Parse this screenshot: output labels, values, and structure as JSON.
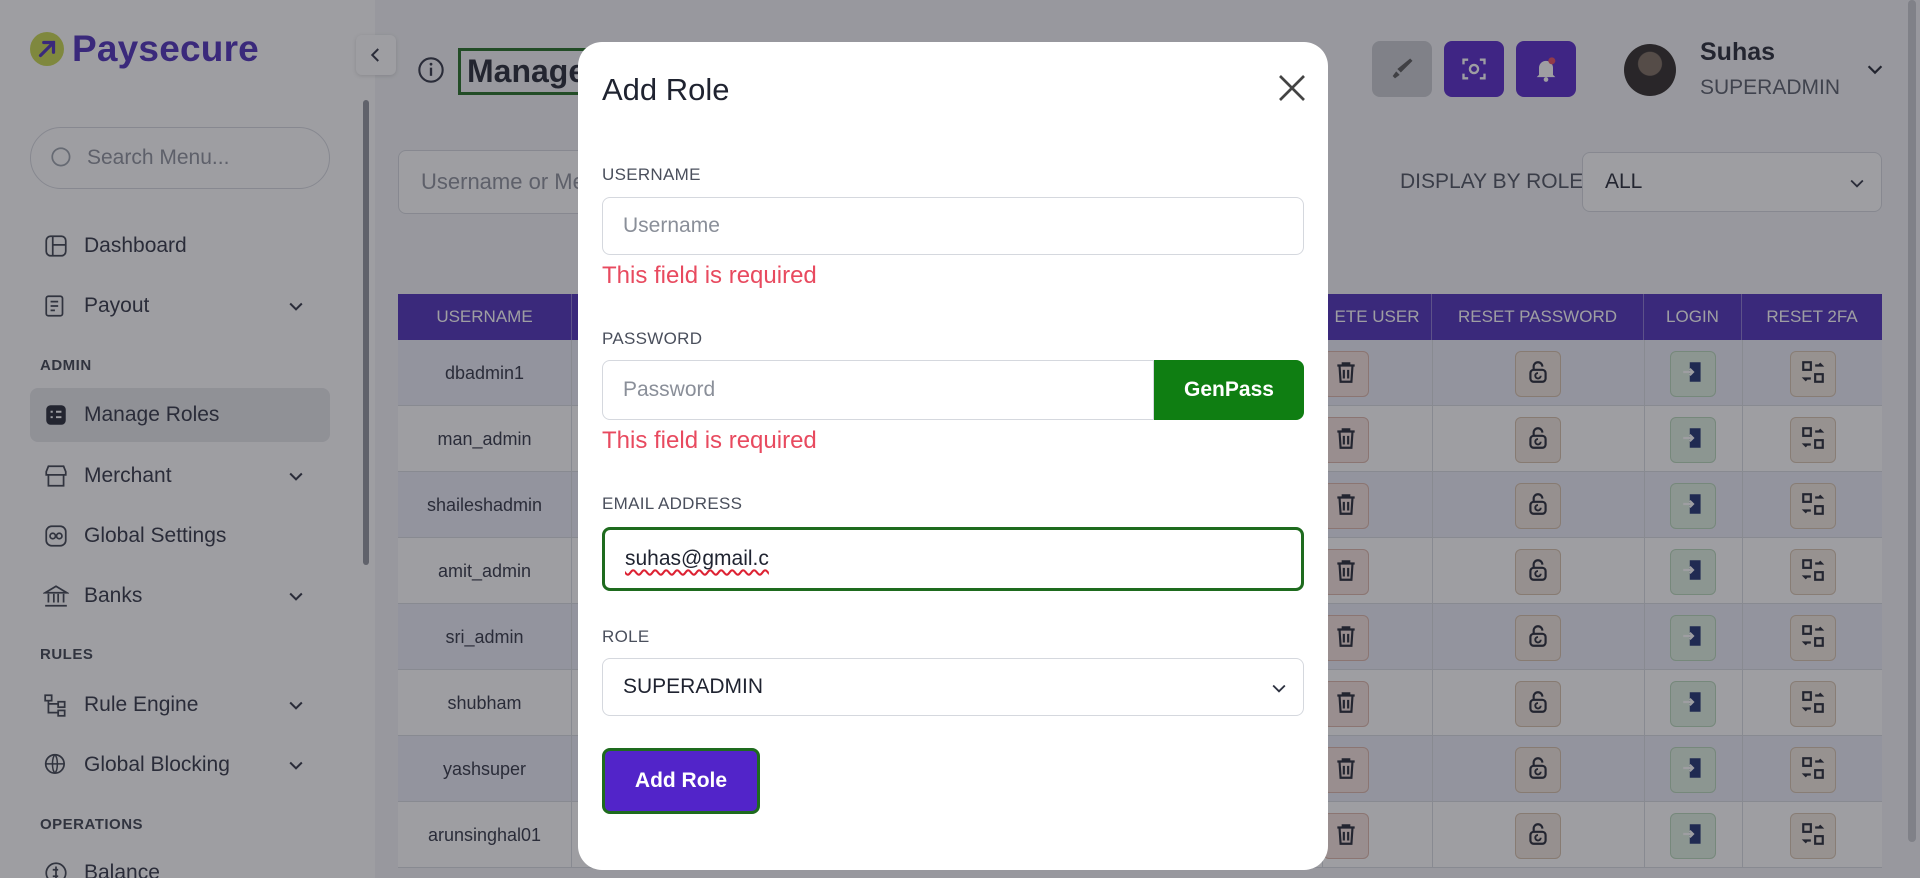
{
  "brand": {
    "name": "Paysecure"
  },
  "sidebar": {
    "search_placeholder": "Search Menu...",
    "sections": {
      "admin": "ADMIN",
      "rules": "RULES",
      "operations": "OPERATIONS"
    },
    "items": [
      {
        "label": "Dashboard",
        "icon": "dashboard-icon"
      },
      {
        "label": "Payout",
        "icon": "payout-icon"
      },
      {
        "label": "Manage Roles",
        "icon": "roles-icon"
      },
      {
        "label": "Merchant",
        "icon": "merchant-icon"
      },
      {
        "label": "Global Settings",
        "icon": "settings-icon"
      },
      {
        "label": "Banks",
        "icon": "bank-icon"
      },
      {
        "label": "Rule Engine",
        "icon": "rule-engine-icon"
      },
      {
        "label": "Global Blocking",
        "icon": "globe-icon"
      },
      {
        "label": "Balance",
        "icon": "balance-icon"
      }
    ]
  },
  "header": {
    "title": "Manage",
    "user_name": "Suhas",
    "user_role": "SUPERADMIN"
  },
  "filters": {
    "search_placeholder": "Username or Me",
    "display_label": "DISPLAY BY ROLE",
    "display_value": "ALL"
  },
  "table": {
    "columns": [
      "USERNAME",
      "ETE USER",
      "RESET PASSWORD",
      "LOGIN",
      "RESET 2FA"
    ],
    "rows": [
      "dbadmin1",
      "man_admin",
      "shaileshadmin",
      "amit_admin",
      "sri_admin",
      "shubham",
      "yashsuper",
      "arunsinghal01"
    ]
  },
  "modal": {
    "title": "Add Role",
    "username_label": "USERNAME",
    "username_placeholder": "Username",
    "username_error": "This field is required",
    "password_label": "PASSWORD",
    "password_placeholder": "Password",
    "password_error": "This field is required",
    "genpass_label": "GenPass",
    "email_label": "EMAIL ADDRESS",
    "email_value": "suhas@gmail.c",
    "role_label": "ROLE",
    "role_value": "SUPERADMIN",
    "submit_label": "Add Role"
  },
  "colors": {
    "brand": "#4a2bb8",
    "accent_green": "#0f7e12",
    "error": "#e84a5f",
    "button": "#5224c9"
  }
}
